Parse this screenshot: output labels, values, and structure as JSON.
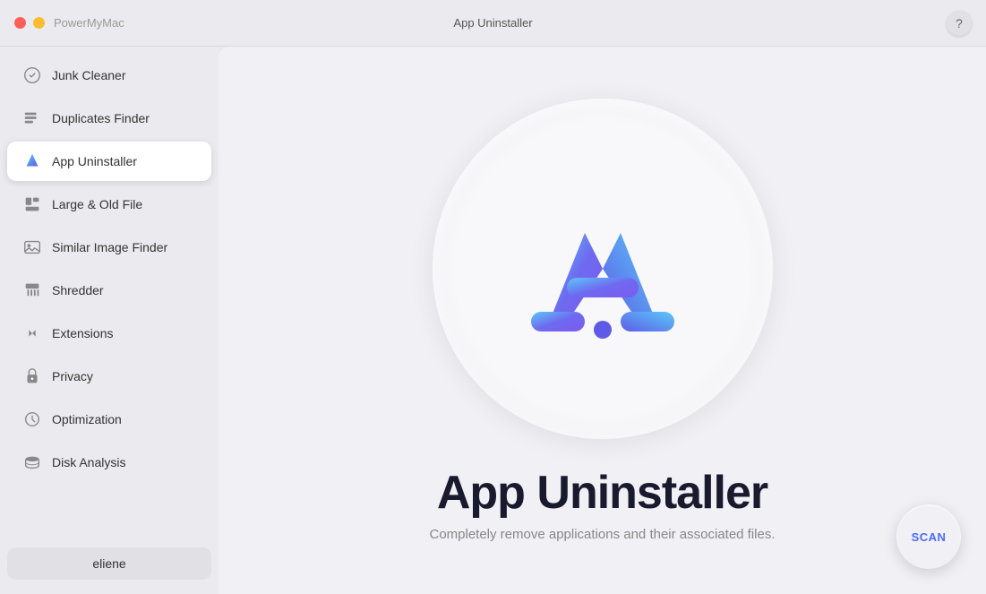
{
  "titlebar": {
    "app_name": "PowerMyMac",
    "center_title": "App Uninstaller",
    "help_label": "?"
  },
  "sidebar": {
    "items": [
      {
        "id": "junk-cleaner",
        "label": "Junk Cleaner",
        "icon": "junk"
      },
      {
        "id": "duplicates-finder",
        "label": "Duplicates Finder",
        "icon": "duplicates"
      },
      {
        "id": "app-uninstaller",
        "label": "App Uninstaller",
        "icon": "app",
        "active": true
      },
      {
        "id": "large-old-file",
        "label": "Large & Old File",
        "icon": "large"
      },
      {
        "id": "similar-image-finder",
        "label": "Similar Image Finder",
        "icon": "image"
      },
      {
        "id": "shredder",
        "label": "Shredder",
        "icon": "shredder"
      },
      {
        "id": "extensions",
        "label": "Extensions",
        "icon": "extensions"
      },
      {
        "id": "privacy",
        "label": "Privacy",
        "icon": "privacy"
      },
      {
        "id": "optimization",
        "label": "Optimization",
        "icon": "optimization"
      },
      {
        "id": "disk-analysis",
        "label": "Disk Analysis",
        "icon": "disk"
      }
    ],
    "user_label": "eliene"
  },
  "content": {
    "title": "App Uninstaller",
    "subtitle": "Completely remove applications and their associated files.",
    "scan_label": "SCAN"
  },
  "colors": {
    "active_bg": "#ffffff",
    "scan_text": "#4a6cf7",
    "title_color": "#1a1a2e"
  }
}
